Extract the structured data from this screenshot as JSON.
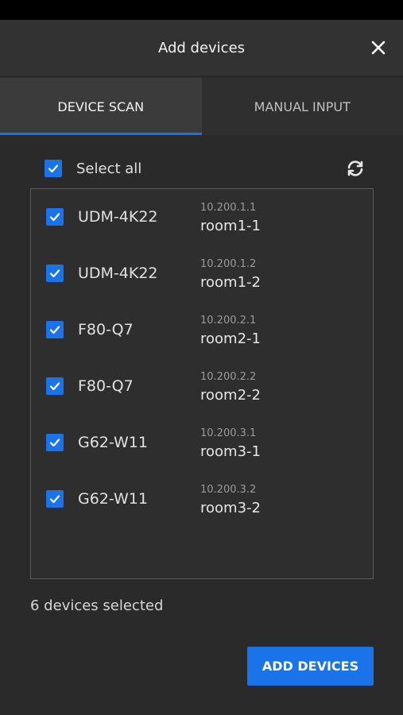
{
  "header": {
    "title": "Add devices"
  },
  "tabs": [
    {
      "label": "DEVICE SCAN",
      "active": true
    },
    {
      "label": "MANUAL INPUT",
      "active": false
    }
  ],
  "select_all": {
    "label": "Select all",
    "checked": true
  },
  "devices": [
    {
      "name": "UDM-4K22",
      "ip": "10.200.1.1",
      "room": "room1-1",
      "checked": true
    },
    {
      "name": "UDM-4K22",
      "ip": "10.200.1.2",
      "room": "room1-2",
      "checked": true
    },
    {
      "name": "F80-Q7",
      "ip": "10.200.2.1",
      "room": "room2-1",
      "checked": true
    },
    {
      "name": "F80-Q7",
      "ip": "10.200.2.2",
      "room": "room2-2",
      "checked": true
    },
    {
      "name": "G62-W11",
      "ip": "10.200.3.1",
      "room": "room3-1",
      "checked": true
    },
    {
      "name": "G62-W11",
      "ip": "10.200.3.2",
      "room": "room3-2",
      "checked": true
    }
  ],
  "footer": {
    "selected_text": "6 devices selected",
    "add_label": "ADD DEVICES"
  },
  "colors": {
    "accent": "#1a73e8",
    "background": "#2a2a2a",
    "header": "#323232"
  },
  "icons": {
    "close": "close-icon",
    "refresh": "refresh-icon",
    "check": "check-icon"
  }
}
